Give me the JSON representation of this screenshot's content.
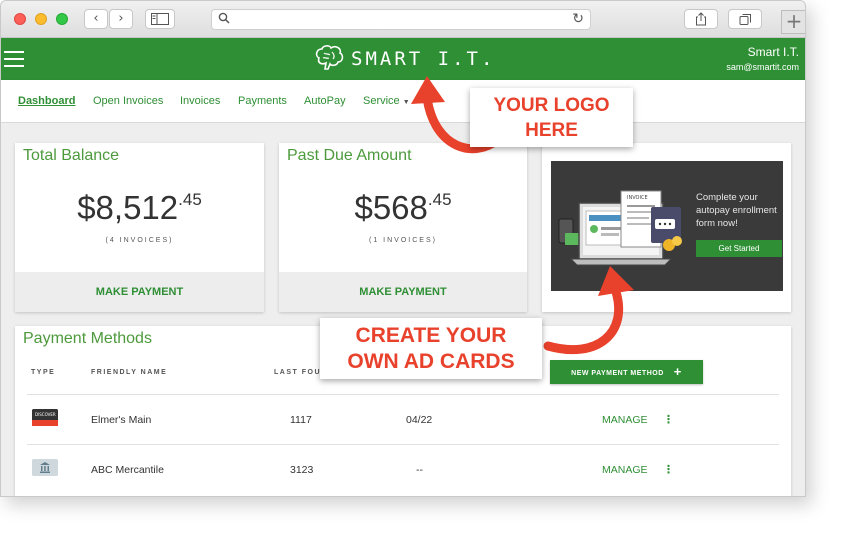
{
  "app": {
    "brand_name": "SMART I.T.",
    "user_name": "Smart I.T.",
    "user_email": "sam@smartit.com"
  },
  "tabs": [
    {
      "label": "Dashboard",
      "active": true
    },
    {
      "label": "Open Invoices"
    },
    {
      "label": "Invoices"
    },
    {
      "label": "Payments"
    },
    {
      "label": "AutoPay"
    },
    {
      "label": "Service"
    }
  ],
  "balance": {
    "title": "Total Balance",
    "amount_main": "$8,512",
    "amount_cents": ".45",
    "count": "(4 INVOICES)",
    "action": "MAKE PAYMENT"
  },
  "past_due": {
    "title": "Past Due Amount",
    "amount_main": "$568",
    "amount_cents": ".45",
    "count": "(1 INVOICES)",
    "action": "MAKE PAYMENT"
  },
  "ad": {
    "text": "Complete your autopay enrollment form now!",
    "button": "Get Started",
    "invoice_label": "INVOICE"
  },
  "payment_methods": {
    "title": "Payment Methods",
    "columns": [
      "TYPE",
      "FRIENDLY NAME",
      "LAST FOU"
    ],
    "add_button": "NEW PAYMENT METHOD",
    "add_symbol": "+",
    "rows": [
      {
        "type": "discover-card",
        "name": "Elmer's Main",
        "last4": "1117",
        "expiry": "04/22",
        "action": "MANAGE"
      },
      {
        "type": "bank",
        "name": "ABC Mercantile",
        "last4": "3123",
        "expiry": "--",
        "action": "MANAGE"
      }
    ]
  },
  "callouts": {
    "logo_line1": "YOUR LOGO",
    "logo_line2": "HERE",
    "ad_line1": "CREATE YOUR",
    "ad_line2": "OWN AD CARDS"
  },
  "colors": {
    "brand_green": "#2f8f35",
    "callout_red": "#e8412c",
    "ad_background": "#3a3a3a"
  }
}
